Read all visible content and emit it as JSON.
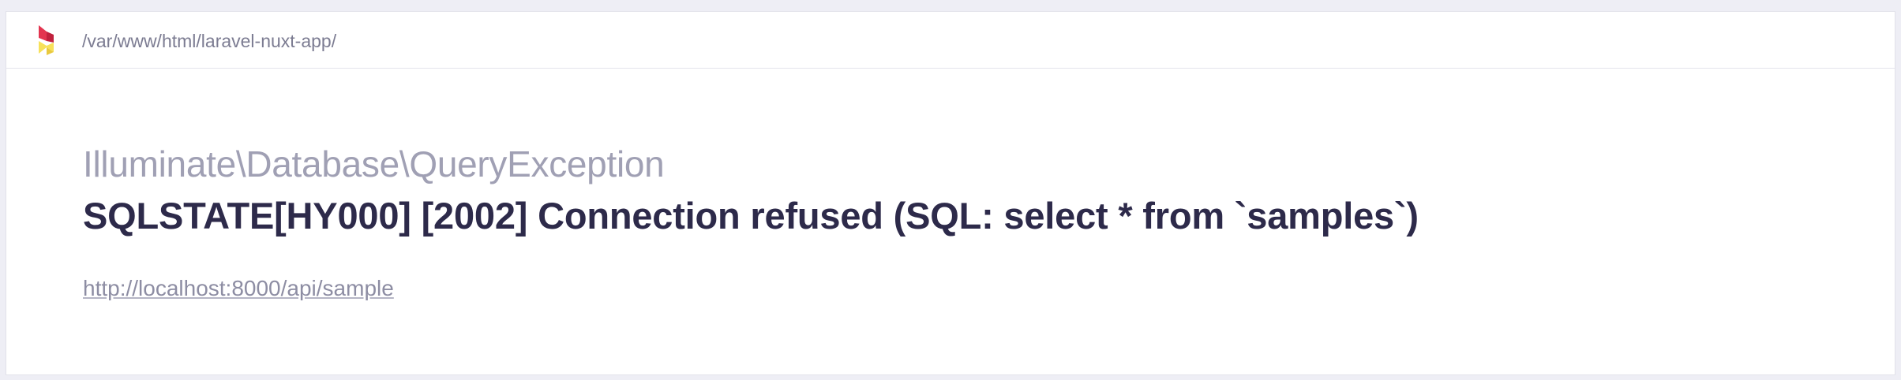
{
  "header": {
    "logo_icon": "ignition-flame-logo",
    "path": "/var/www/html/laravel-nuxt-app/"
  },
  "error": {
    "exception_class": "Illuminate\\Database\\QueryException",
    "message": "SQLSTATE[HY000] [2002] Connection refused (SQL: select * from `samples`)",
    "url": "http://localhost:8000/api/sample"
  },
  "colors": {
    "background": "#eeeef5",
    "card": "#ffffff",
    "exception_class": "#a0a0b4",
    "message": "#2d2a4a",
    "path": "#7c7c92",
    "logo_red": "#e3344f",
    "logo_yellow": "#f7e15a"
  }
}
